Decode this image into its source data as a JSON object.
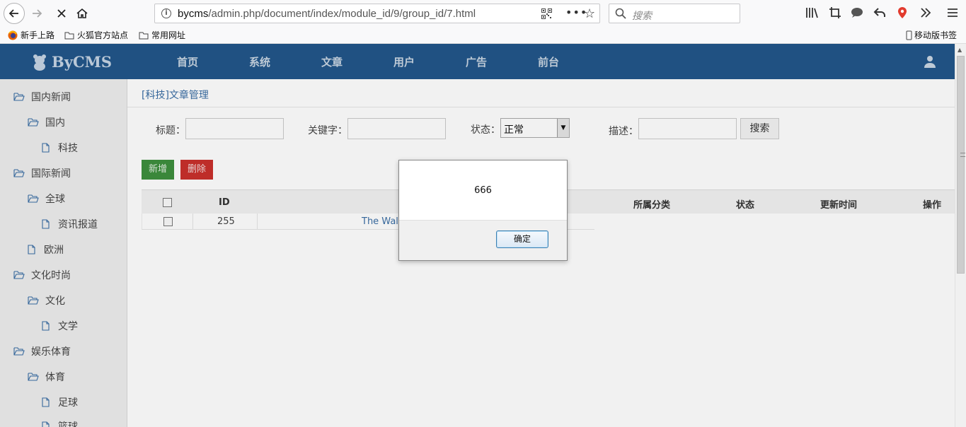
{
  "browser": {
    "url_host": "bycms",
    "url_path": "/admin.php/document/index/module_id/9/group_id/7.html",
    "search_placeholder": "搜索",
    "bookmarks": [
      {
        "label": "新手上路",
        "icon": "firefox-icon"
      },
      {
        "label": "火狐官方站点",
        "icon": "folder-icon"
      },
      {
        "label": "常用网址",
        "icon": "folder-icon"
      }
    ],
    "mobile_bookmarks": "移动版书签"
  },
  "header": {
    "logo": "ByCMS",
    "nav": [
      "首页",
      "系统",
      "文章",
      "用户",
      "广告",
      "前台"
    ],
    "bg_color": "#22568a"
  },
  "sidebar": {
    "items": [
      {
        "label": "国内新闻",
        "level": 0,
        "icon": "folder-open-icon"
      },
      {
        "label": "国内",
        "level": 1,
        "icon": "folder-open-icon"
      },
      {
        "label": "科技",
        "level": 2,
        "icon": "file-icon"
      },
      {
        "label": "国际新闻",
        "level": 0,
        "icon": "folder-open-icon"
      },
      {
        "label": "全球",
        "level": 1,
        "icon": "folder-open-icon"
      },
      {
        "label": "资讯报道",
        "level": 2,
        "icon": "file-icon"
      },
      {
        "label": "欧洲",
        "level": 1,
        "icon": "file-icon"
      },
      {
        "label": "文化时尚",
        "level": 0,
        "icon": "folder-open-icon"
      },
      {
        "label": "文化",
        "level": 1,
        "icon": "folder-open-icon"
      },
      {
        "label": "文学",
        "level": 2,
        "icon": "file-icon"
      },
      {
        "label": "娱乐体育",
        "level": 0,
        "icon": "folder-open-icon"
      },
      {
        "label": "体育",
        "level": 1,
        "icon": "folder-open-icon"
      },
      {
        "label": "足球",
        "level": 2,
        "icon": "file-icon"
      },
      {
        "label": "篮球",
        "level": 2,
        "icon": "file-icon"
      }
    ]
  },
  "main": {
    "breadcrumb": "[科技]文章管理",
    "filters": {
      "title_label": "标题：",
      "keyword_label": "关键字：",
      "status_label": "状态：",
      "status_value": "正常",
      "desc_label": "描述：",
      "search_button": "搜索"
    },
    "add_button": "新增",
    "delete_button": "删除",
    "table": {
      "headers": {
        "id": "ID",
        "category": "所属分类",
        "status": "状态",
        "updated": "更新时间",
        "action": "操作"
      },
      "rows": [
        {
          "id": "255",
          "title": "The Wallc"
        }
      ]
    }
  },
  "dialog": {
    "message": "666",
    "ok_label": "确定"
  }
}
